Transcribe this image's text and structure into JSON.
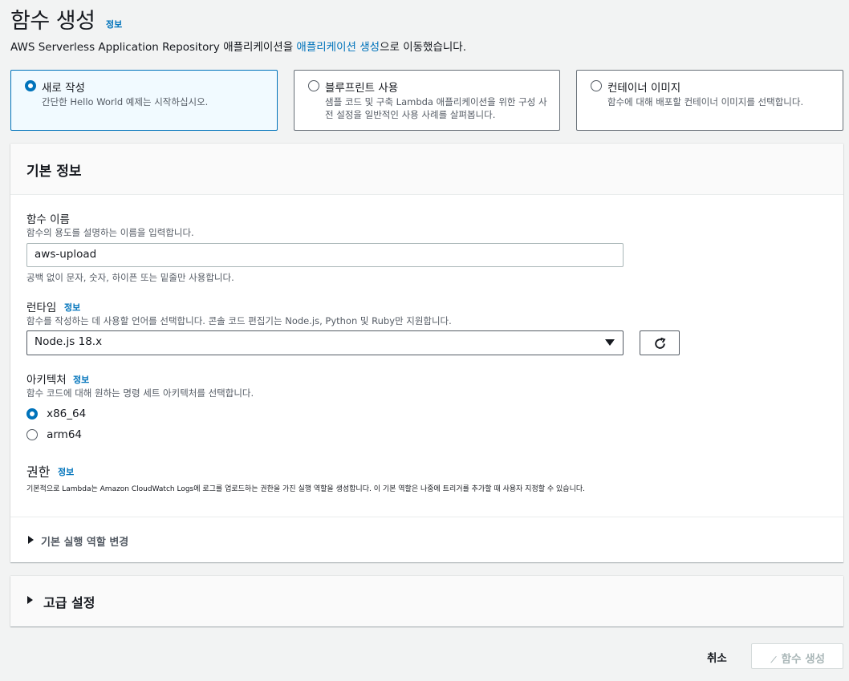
{
  "header": {
    "title": "함수 생성",
    "info": "정보",
    "subtitle_prefix": "AWS Serverless Application Repository 애플리케이션을 ",
    "subtitle_link": "애플리케이션 생성",
    "subtitle_suffix": "으로 이동했습니다."
  },
  "options": [
    {
      "title": "새로 작성",
      "desc": "간단한 Hello World 예제는 시작하십시오.",
      "selected": true
    },
    {
      "title": "블루프린트 사용",
      "desc": "샘플 코드 및 구축 Lambda 애플리케이션을 위한 구성 사전 설정을 일반적인 사용 사례를 살펴봅니다.",
      "selected": false
    },
    {
      "title": "컨테이너 이미지",
      "desc": "함수에 대해 배포할 컨테이너 이미지를 선택합니다.",
      "selected": false
    }
  ],
  "basic": {
    "title": "기본 정보",
    "function_name": {
      "label": "함수 이름",
      "desc": "함수의 용도를 설명하는 이름을 입력합니다.",
      "value": "aws-upload",
      "hint": "공백 없이 문자, 숫자, 하이픈 또는 밑줄만 사용합니다."
    },
    "runtime": {
      "label": "런타임",
      "info": "정보",
      "desc": "함수를 작성하는 데 사용할 언어를 선택합니다. 콘솔 코드 편집기는 Node.js, Python 및 Ruby만 지원합니다.",
      "value": "Node.js 18.x"
    },
    "architecture": {
      "label": "아키텍처",
      "info": "정보",
      "desc": "함수 코드에 대해 원하는 명령 세트 아키텍처를 선택합니다.",
      "options": [
        {
          "label": "x86_64",
          "selected": true
        },
        {
          "label": "arm64",
          "selected": false
        }
      ]
    },
    "permissions": {
      "label": "권한",
      "info": "정보",
      "desc": "기본적으로 Lambda는 Amazon CloudWatch Logs에 로그를 업로드하는 권한을 가진 실행 역할을 생성합니다. 이 기본 역할은 나중에 트리거를 추가할 때 사용자 지정할 수 있습니다."
    },
    "change_role": "기본 실행 역할 변경"
  },
  "advanced": {
    "title": "고급 설정"
  },
  "footer": {
    "cancel": "취소",
    "create": "함수 생성"
  },
  "colors": {
    "accent": "#0073bb",
    "background": "#f2f3f3"
  }
}
